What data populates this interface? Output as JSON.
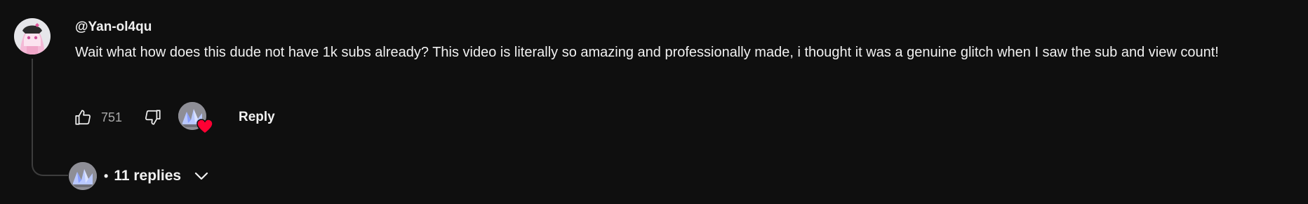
{
  "comment": {
    "author": "@Yan-ol4qu",
    "text": "Wait what how does this dude not have 1k subs already? This video is literally so amazing and professionally made, i thought it was a genuine glitch when I saw the sub and view count!",
    "like_count": "751",
    "reply_label": "Reply",
    "author_avatar_icon": "anime-avatar-icon",
    "creator_heart_icon": "heart-icon"
  },
  "replies": {
    "dot": "•",
    "label": "11 replies",
    "expand_icon": "chevron-down-icon"
  },
  "colors": {
    "background": "#0f0f0f",
    "text": "#f1f1f1",
    "secondary_text": "#aaaaaa",
    "heart": "#ff0033"
  }
}
